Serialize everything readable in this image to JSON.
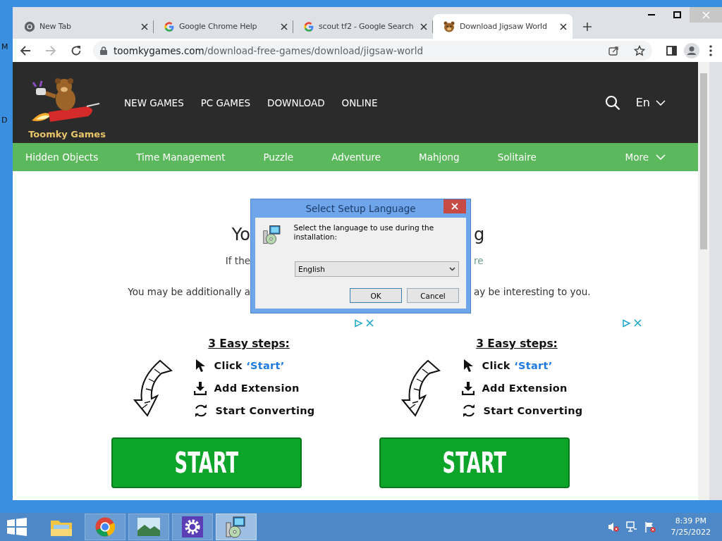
{
  "desktop": {
    "edge_labels": [
      "M",
      "D"
    ]
  },
  "browser": {
    "tabs": [
      {
        "title": "New Tab",
        "kind": "chrome",
        "selected": false
      },
      {
        "title": "Google Chrome Help",
        "kind": "google",
        "selected": false
      },
      {
        "title": "scout tf2 - Google Search",
        "kind": "google",
        "selected": false
      },
      {
        "title": "Download Jigsaw World",
        "kind": "bear",
        "selected": true
      }
    ],
    "url_host": "toomkygames.com",
    "url_path": "/download-free-games/download/jigsaw-world"
  },
  "site": {
    "logo_text": "Toomky Games",
    "nav": [
      "NEW GAMES",
      "PC GAMES",
      "DOWNLOAD",
      "ONLINE"
    ],
    "language": "En",
    "categories": [
      "Hidden Objects",
      "Time Management",
      "Puzzle",
      "Adventure",
      "Mahjong",
      "Solitaire"
    ],
    "more": "More",
    "lines": [
      {
        "kind": "heading",
        "left": "Yo",
        "right": "g"
      },
      {
        "kind": "note",
        "left": "If the",
        "right": "re"
      },
      {
        "kind": "text",
        "left": "You may be additionally a",
        "right": "ay be interesting to you."
      }
    ],
    "ads": [
      {
        "title": "3 Easy steps:",
        "steps": [
          {
            "kind": "click",
            "text": "Click",
            "highlight": "‘Start’"
          },
          {
            "kind": "download",
            "text": "Add Extension"
          },
          {
            "kind": "convert",
            "text": "Start Converting"
          }
        ],
        "button": "START"
      },
      {
        "title": "3 Easy steps:",
        "steps": [
          {
            "kind": "click",
            "text": "Click",
            "highlight": "‘Start’"
          },
          {
            "kind": "download",
            "text": "Add Extension"
          },
          {
            "kind": "convert",
            "text": "Start Converting"
          }
        ],
        "button": "START"
      }
    ]
  },
  "dialog": {
    "title": "Select Setup Language",
    "message": "Select the language to use during the installation:",
    "language": "English",
    "buttons": [
      "OK",
      "Cancel"
    ]
  },
  "taskbar": {
    "apps": [
      {
        "kind": "explorer",
        "selected": false
      },
      {
        "kind": "chrome",
        "selected": false
      },
      {
        "kind": "photos",
        "selected": false
      },
      {
        "kind": "settings",
        "selected": false
      },
      {
        "kind": "setup",
        "selected": true
      }
    ],
    "time": "8:39 PM",
    "date": "7/25/2022"
  }
}
